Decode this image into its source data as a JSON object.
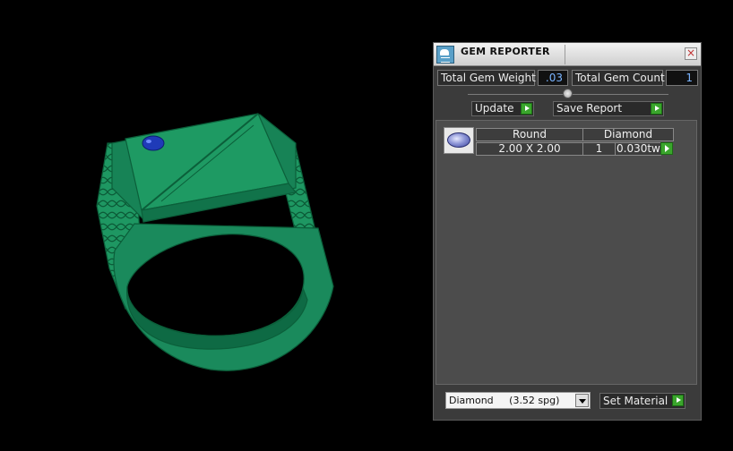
{
  "panel": {
    "title": "GEM REPORTER",
    "close_label": "×",
    "total_weight": {
      "label": "Total Gem Weight",
      "value": ".03"
    },
    "total_count": {
      "label": "Total Gem Count",
      "value": "1"
    },
    "update_label": "Update",
    "save_report_label": "Save Report",
    "gems": [
      {
        "shape": "Round",
        "material": "Diamond",
        "size": "2.00 X 2.00",
        "count": "1",
        "weight": "0.030tw",
        "icon": "round-gem-icon"
      }
    ],
    "material_select": {
      "value": "Diamond     (3.52 spg)"
    },
    "set_material_label": "Set Material"
  },
  "colors": {
    "ring": "#1a8a5c",
    "gem": "#1f3bb8",
    "accent_go": "#3aa52c"
  }
}
